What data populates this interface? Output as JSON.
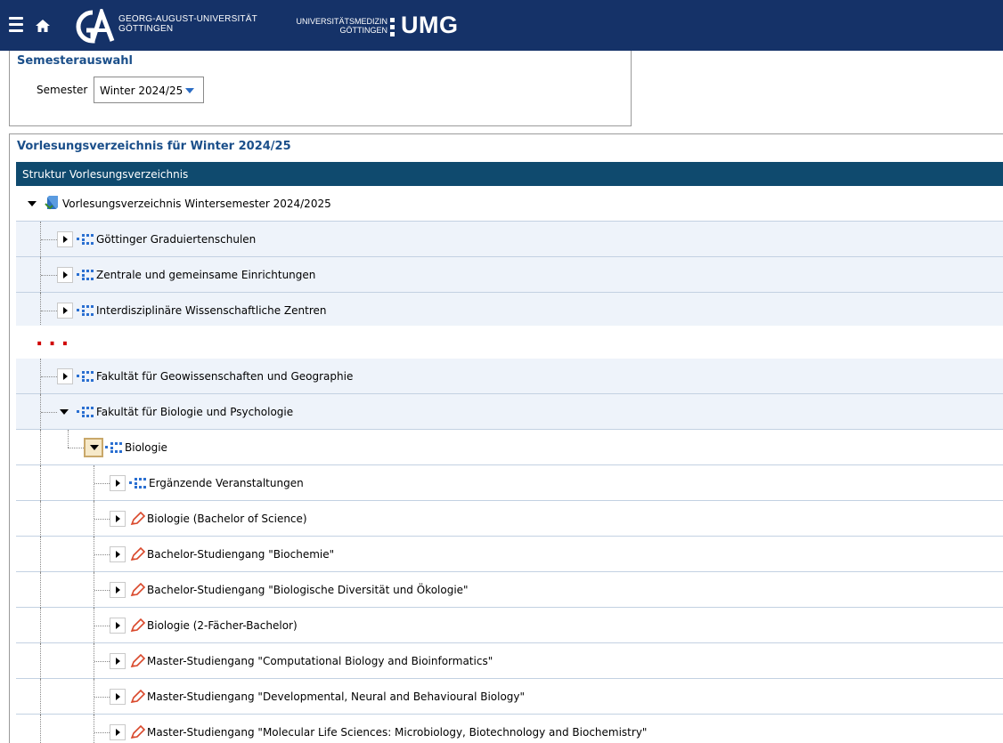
{
  "header": {
    "goe_line1": "GEORG-AUGUST-UNIVERSITÄT",
    "goe_line2": "GÖTTINGEN",
    "umg_line1": "UNIVERSITÄTSMEDIZIN",
    "umg_line2": "GÖTTINGEN",
    "umg_logo": "UMG",
    "brand_color": "#153268"
  },
  "semester": {
    "title": "Semesterauswahl",
    "label": "Semester",
    "selected": "Winter 2024/25"
  },
  "directory": {
    "title": "Vorlesungsverzeichnis für Winter 2024/25",
    "structure_header": "Struktur Vorlesungsverzeichnis",
    "root": "Vorlesungsverzeichnis Wintersemester 2024/2025",
    "top_items": [
      "Göttinger Graduiertenschulen",
      "Zentrale und gemeinsame Einrichtungen",
      "Interdisziplinäre Wissenschaftliche Zentren"
    ],
    "ellipsis": "...",
    "lower_items": [
      "Fakultät für Geowissenschaften und Geographie",
      "Fakultät für Biologie und Psychologie"
    ],
    "biologie": "Biologie",
    "children": [
      "Ergänzende Veranstaltungen",
      "Biologie (Bachelor of Science)",
      "Bachelor-Studiengang \"Biochemie\"",
      "Bachelor-Studiengang \"Biologische Diversität und Ökologie\"",
      "Biologie (2-Fächer-Bachelor)",
      "Master-Studiengang \"Computational Biology and Bioinformatics\"",
      "Master-Studiengang \"Developmental, Neural and Behavioural Biology\"",
      "Master-Studiengang \"Molecular Life Sciences: Microbiology, Biotechnology and Biochemistry\""
    ]
  }
}
